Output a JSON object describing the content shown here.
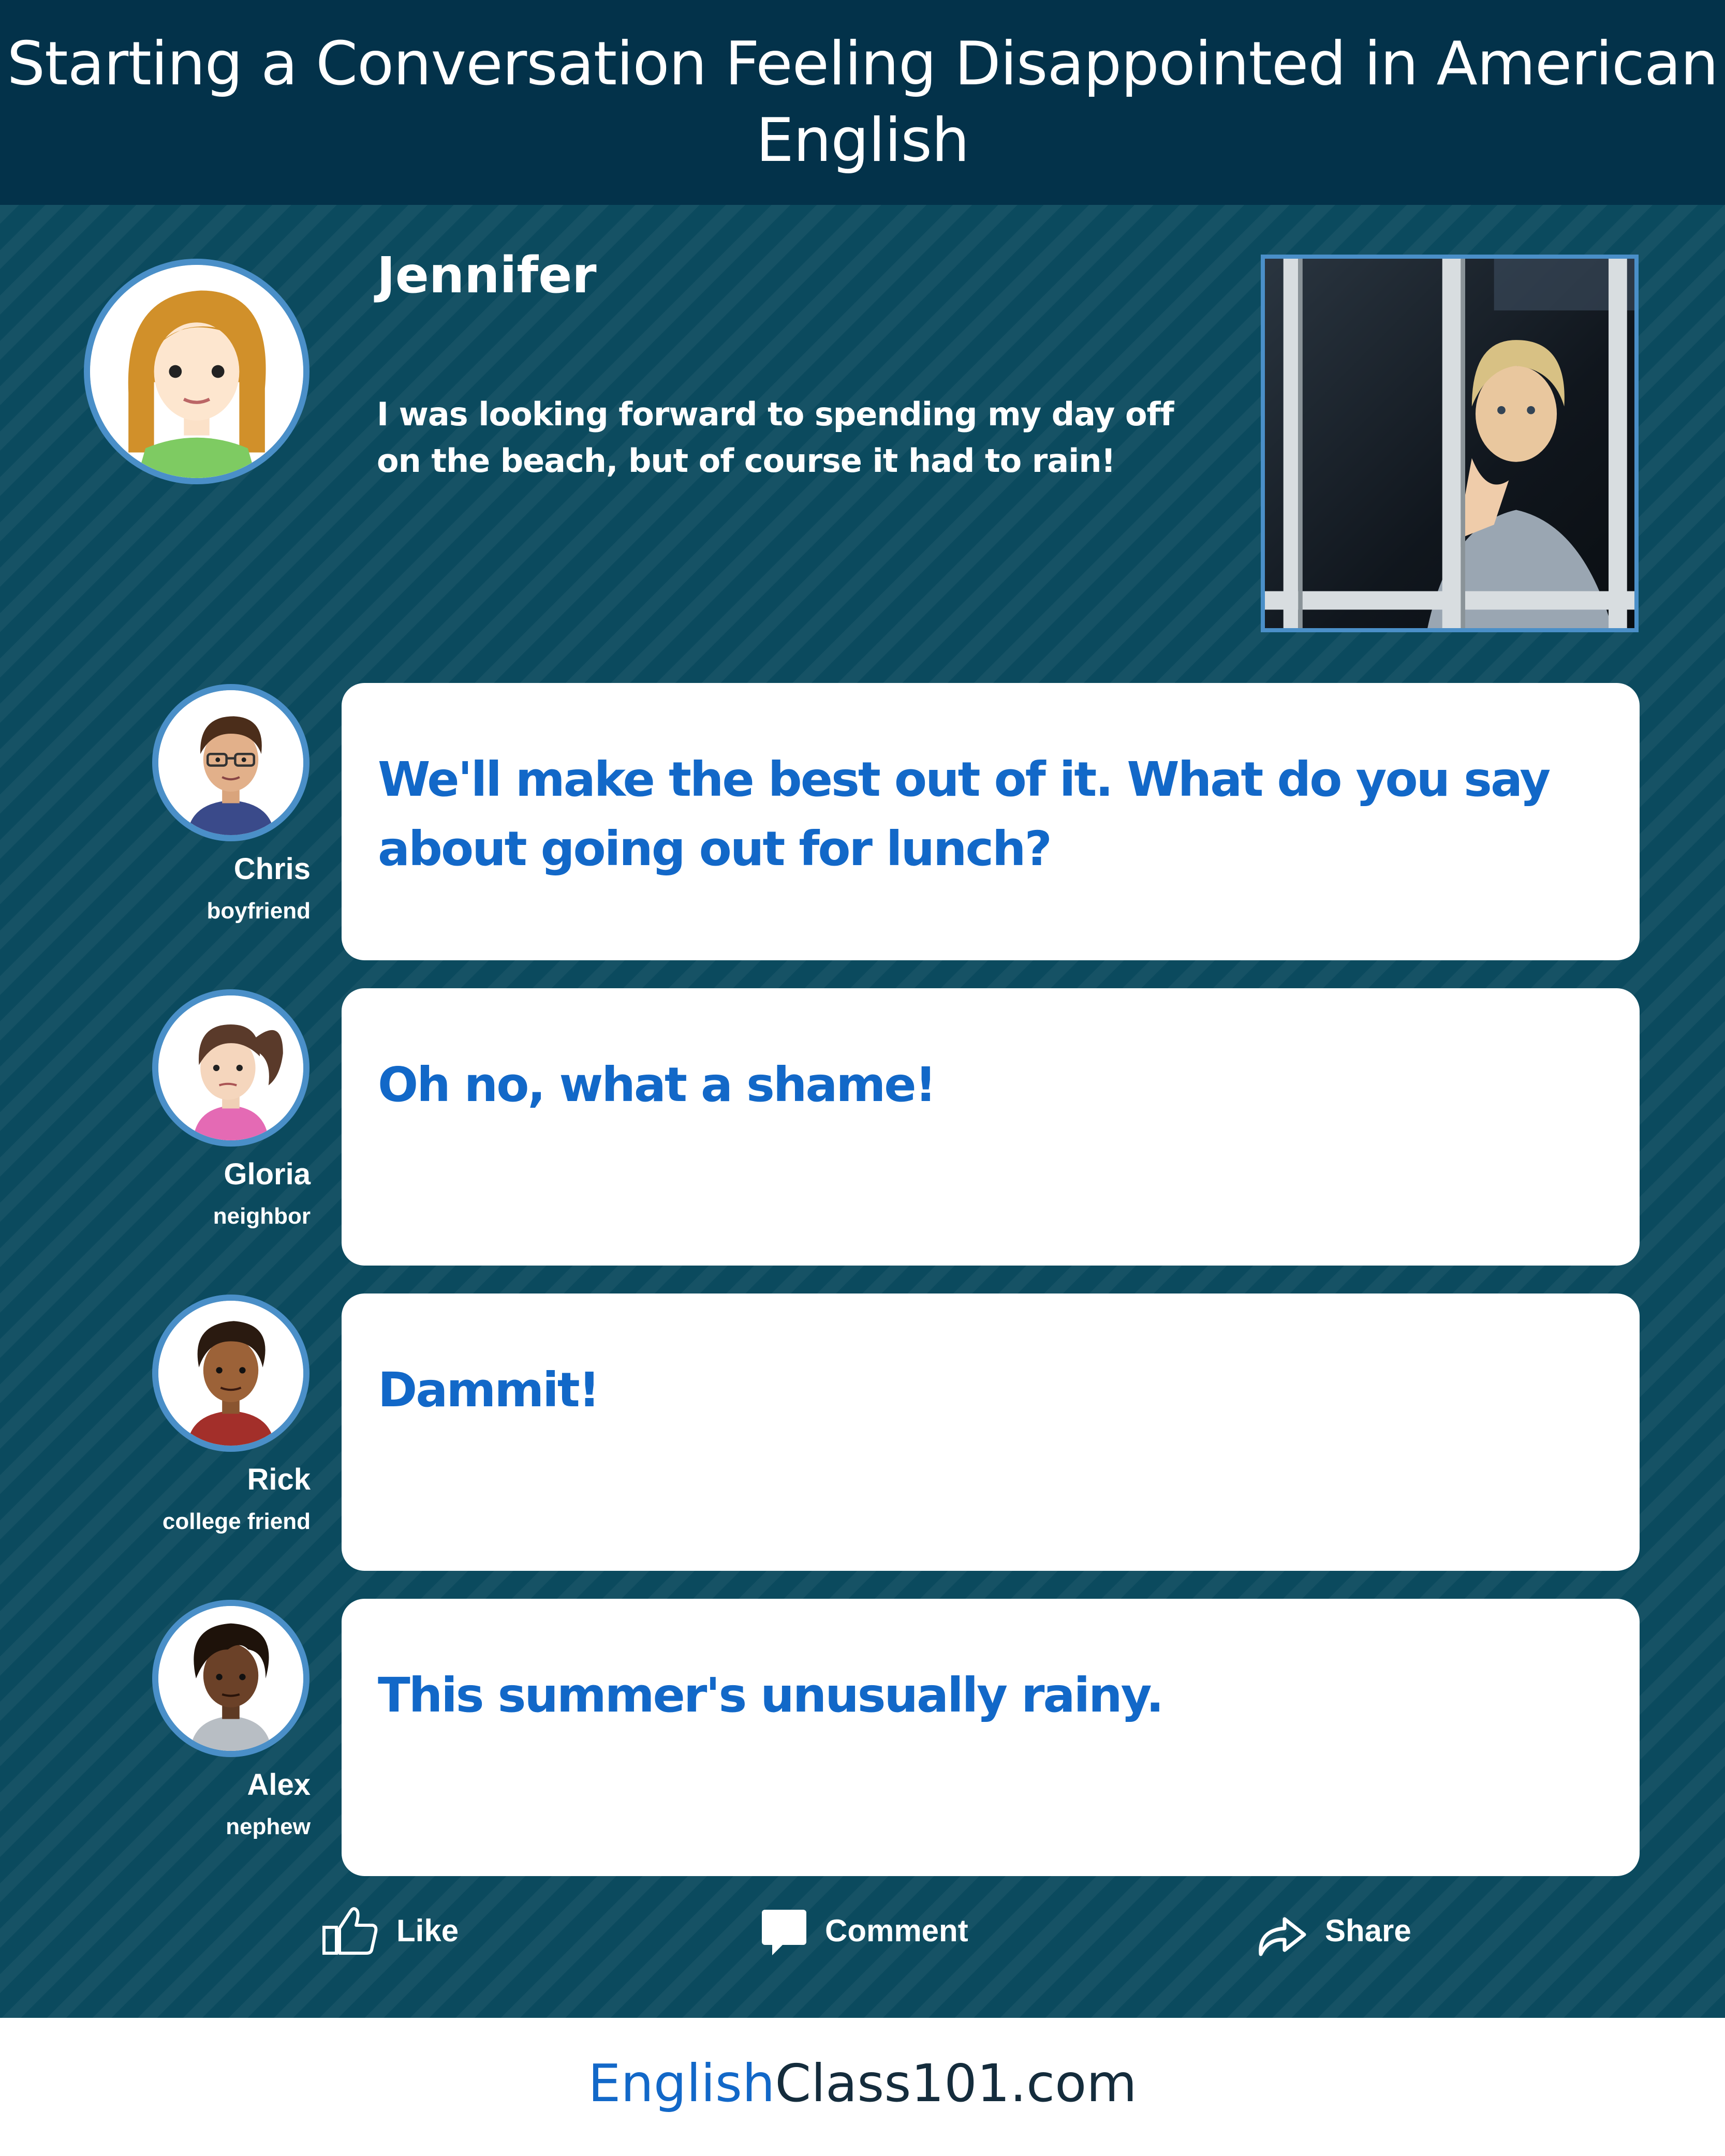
{
  "header": {
    "title": "Starting a Conversation Feeling Disappointed in American English"
  },
  "post": {
    "author": "Jennifer",
    "message": "I was looking forward to spending my day off on the beach, but of course it had to rain!"
  },
  "replies": [
    {
      "name": "Chris",
      "relation": "boyfriend",
      "text": "We'll make the best out of it. What do you say about going out for lunch?"
    },
    {
      "name": "Gloria",
      "relation": "neighbor",
      "text": "Oh no, what a shame!"
    },
    {
      "name": "Rick",
      "relation": "college friend",
      "text": "Dammit!"
    },
    {
      "name": "Alex",
      "relation": "nephew",
      "text": "This summer's unusually rainy."
    }
  ],
  "actions": {
    "like": {
      "label": "Like",
      "icon": "thumbs-up-icon"
    },
    "comment": {
      "label": "Comment",
      "icon": "speech-bubble-icon"
    },
    "share": {
      "label": "Share",
      "icon": "share-arrow-icon"
    }
  },
  "footer": {
    "brand_part1": "English",
    "brand_part2": "Class101.com"
  },
  "colors": {
    "header_bg": "#03324a",
    "main_bg": "#0b4a5e",
    "accent_blue": "#1268c8",
    "avatar_ring": "#4a8fc8"
  }
}
